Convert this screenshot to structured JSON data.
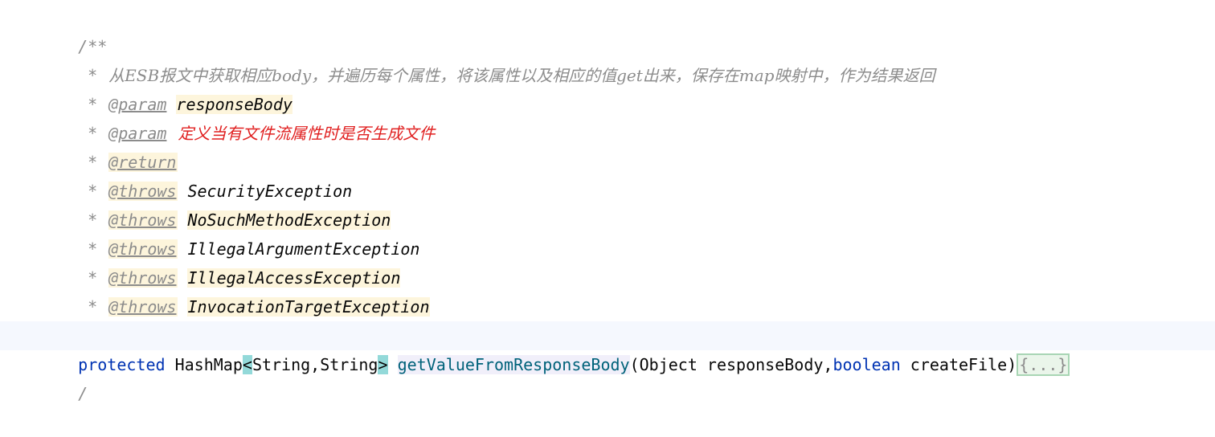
{
  "editor": {
    "doc_open": "/**",
    "summary": {
      "prefix": "* ",
      "text": "从ESB报文中获取相应body，并遍历每个属性，将该属性以及相应的值get出来，保存在map映射中，作为结果返回"
    },
    "params": [
      {
        "tag": "@param",
        "name": "responseBody"
      },
      {
        "tag": "@param",
        "name": "定义当有文件流属性时是否生成文件"
      }
    ],
    "return_tag": "@return",
    "throws": [
      {
        "tag": "@throws",
        "exception": "SecurityException"
      },
      {
        "tag": "@throws",
        "exception": "NoSuchMethodException"
      },
      {
        "tag": "@throws",
        "exception": "IllegalArgumentException"
      },
      {
        "tag": "@throws",
        "exception": "IllegalAccessException"
      },
      {
        "tag": "@throws",
        "exception": "InvocationTargetException"
      }
    ],
    "doc_close": "*/",
    "signature": {
      "modifier": "protected",
      "return_type": "HashMap",
      "lt": "<",
      "generic_args": "String,String",
      "gt": ">",
      "method_name": "getValueFromResponseBody",
      "open_paren": "(",
      "param1_type": "Object",
      "param1_name": "responseBody",
      "comma": ",",
      "param2_type": "boolean",
      "param2_name": "createFile",
      "close_paren": ")",
      "folded_body": "{...}"
    },
    "next_line_fragment": "/"
  },
  "colors": {
    "keyword": "#0033b3",
    "method": "#00627a",
    "doc_comment": "#8c8c8c",
    "error_text": "#e02020",
    "tag_highlight": "#fdf5dc",
    "brace_match": "#93d9d9",
    "current_line": "#f5f8fe"
  }
}
